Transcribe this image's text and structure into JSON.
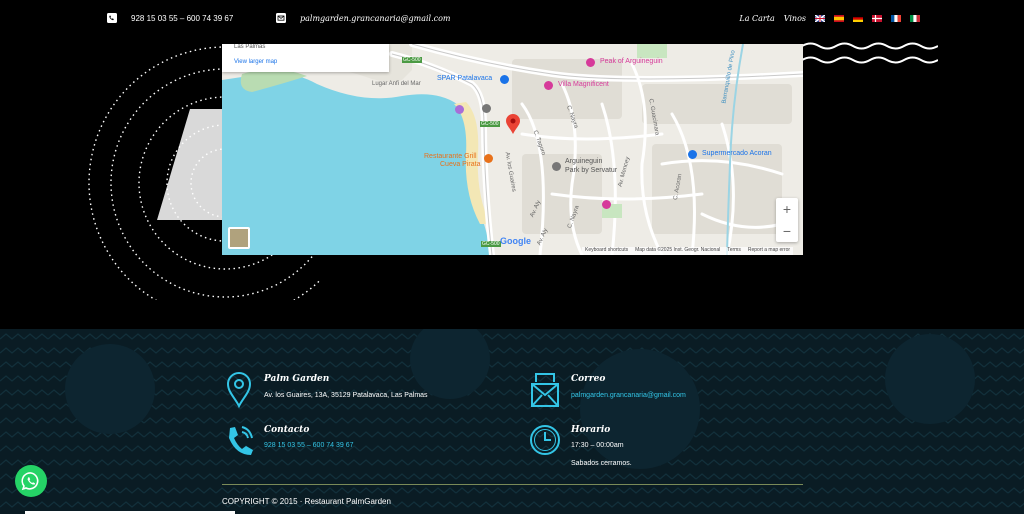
{
  "topbar": {
    "phone": "928 15 03 55 – 600 74 39 67",
    "email": "palmgarden.grancanaria@gmail.com",
    "nav": [
      {
        "label": "La Carta"
      },
      {
        "label": "Vinos"
      }
    ],
    "languages": [
      {
        "code": "en",
        "icon": "uk-flag-icon"
      },
      {
        "code": "es",
        "icon": "spain-flag-icon"
      },
      {
        "code": "de",
        "icon": "germany-flag-icon"
      },
      {
        "code": "da",
        "icon": "denmark-flag-icon"
      },
      {
        "code": "fr",
        "icon": "france-flag-icon"
      },
      {
        "code": "it",
        "icon": "italy-flag-icon"
      }
    ]
  },
  "map": {
    "card": {
      "city": "Las Palmas",
      "link": "View larger map"
    },
    "places": {
      "peak": "Peak of Arguineguin",
      "spar": "SPAR Patalavaca",
      "villa": "Villa Magnificent",
      "restaurant_line1": "Restaurante Grill",
      "restaurant_line2": "Cueva Pirata",
      "park_line1": "Arguineguin",
      "park_line2": "Park by Servatur",
      "supermarket": "Supermercado Acoran"
    },
    "streets": {
      "lugar": "Lugar Anfi del Mar",
      "gc500a": "GC-500",
      "gc500b": "GC-500",
      "gc500c": "GC-500",
      "guaires": "Av. los Guaires",
      "aly1": "Av. Aly",
      "aly2": "Av. Aly",
      "nayra1": "C. Nayra",
      "nayra2": "C. Nayra",
      "tagoro": "C. Tagoro",
      "mencey": "Av. Mencey",
      "barranquillo": "Barranquillo de Pino",
      "guacimara": "C. Guacimara",
      "acoran": "C. Acoran"
    },
    "zoom_in": "+",
    "zoom_out": "−",
    "google": "Google",
    "attribution": [
      "Keyboard shortcuts",
      "Map data ©2025 Inst. Geogr. Nacional",
      "Terms",
      "Report a map error"
    ]
  },
  "footer": {
    "address": {
      "title": "Palm Garden",
      "text": "Av. los Guaires, 13A, 35129 Patalavaca, Las Palmas",
      "icon": "map-pin-icon"
    },
    "email": {
      "title": "Correo",
      "text": "palmgarden.grancanaria@gmail.com",
      "icon": "envelope-icon"
    },
    "contact": {
      "title": "Contacto",
      "text": "928 15 03 55 – 600 74 39 67",
      "icon": "phone-icon"
    },
    "hours": {
      "title": "Horario",
      "line1": "17:30 – 00:00am",
      "line2": "Sabados cerramos.",
      "icon": "clock-icon"
    },
    "copyright": "COPYRIGHT © 2015 · Restaurant PalmGarden"
  },
  "colors": {
    "background": "#000000",
    "footer": "#0a1c24",
    "accent": "#33c5e6",
    "whatsapp": "#25d366"
  }
}
